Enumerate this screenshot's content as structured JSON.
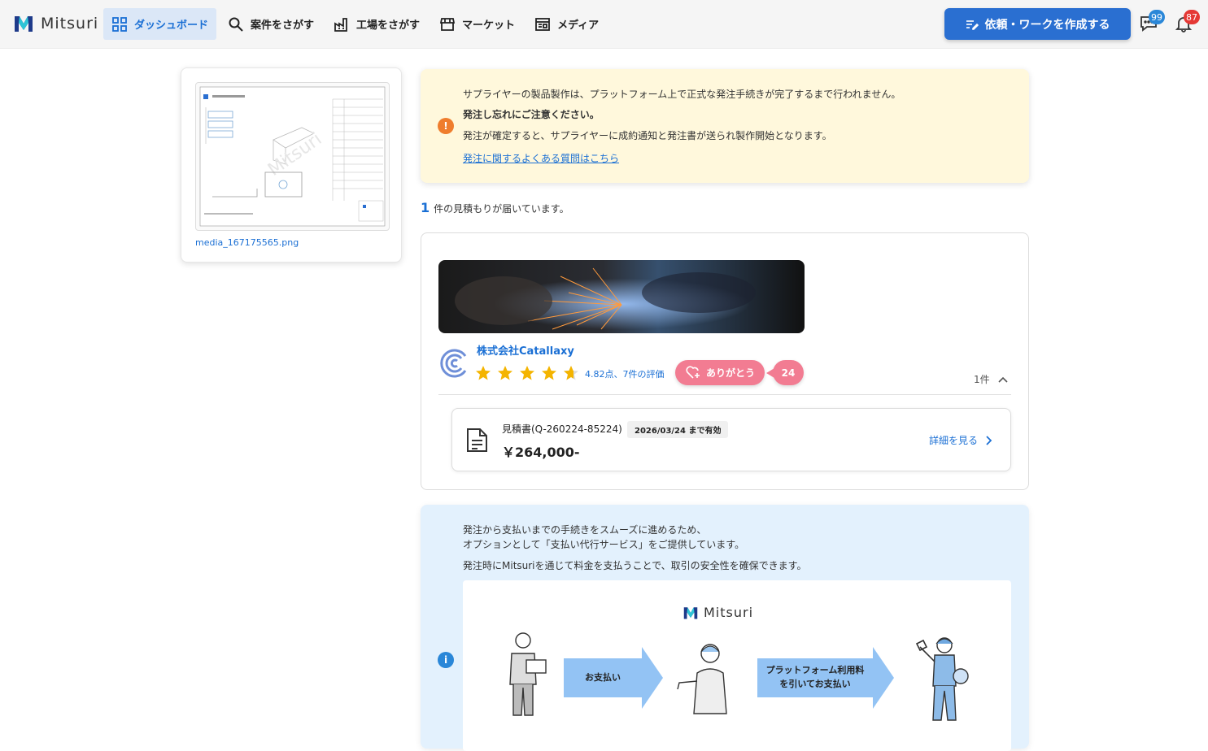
{
  "header": {
    "logo_text": "Mitsuri",
    "nav": [
      {
        "label": "ダッシュボード",
        "icon": "dashboard-icon"
      },
      {
        "label": "案件をさがす",
        "icon": "search-icon"
      },
      {
        "label": "工場をさがす",
        "icon": "factory-icon"
      },
      {
        "label": "マーケット",
        "icon": "store-icon"
      },
      {
        "label": "メディア",
        "icon": "newspaper-icon"
      }
    ],
    "create_button": "依頼・ワークを作成する",
    "messages_badge": "99",
    "notifications_badge": "87",
    "colors": {
      "accent": "#2a6fd1",
      "badge_blue": "#2a87d8",
      "badge_red": "#e53935"
    }
  },
  "file": {
    "name": "media_167175565.png"
  },
  "warning": {
    "line1": "サプライヤーの製品製作は、プラットフォーム上で正式な発注手続きが完了するまで行われません。",
    "line2": "発注し忘れにご注意ください。",
    "line3": "発注が確定すると、サプライヤーに成約通知と発注書が送られ製作開始となります。",
    "link": "発注に関するよくある質問はこちら",
    "color": "#fff8dc"
  },
  "quotes_summary": {
    "count": "1",
    "text": "件の見積もりが届いています。"
  },
  "supplier": {
    "name": "株式会社Catallaxy",
    "rating": 4.82,
    "rating_text": "4.82点、7件の評価",
    "thanks_label": "ありがとう",
    "thanks_count": "24",
    "items_count": "1件"
  },
  "quote": {
    "id": "見積書(Q-260224-85224)",
    "valid": "2026/03/24 まで有効",
    "price": "￥264,000-",
    "detail_link": "詳細を見る"
  },
  "info": {
    "line1": "発注から支払いまでの手続きをスムーズに進めるため、",
    "line2": "オプションとして「支払い代行サービス」をご提供しています。",
    "line3": "発注時にMitsuriを通じて料金を支払うことで、取引の安全性を確保できます。",
    "diagram_logo": "Mitsuri",
    "arrow1": "お支払い",
    "arrow2_line1": "プラットフォーム利用料",
    "arrow2_line2": "を引いてお支払い"
  }
}
